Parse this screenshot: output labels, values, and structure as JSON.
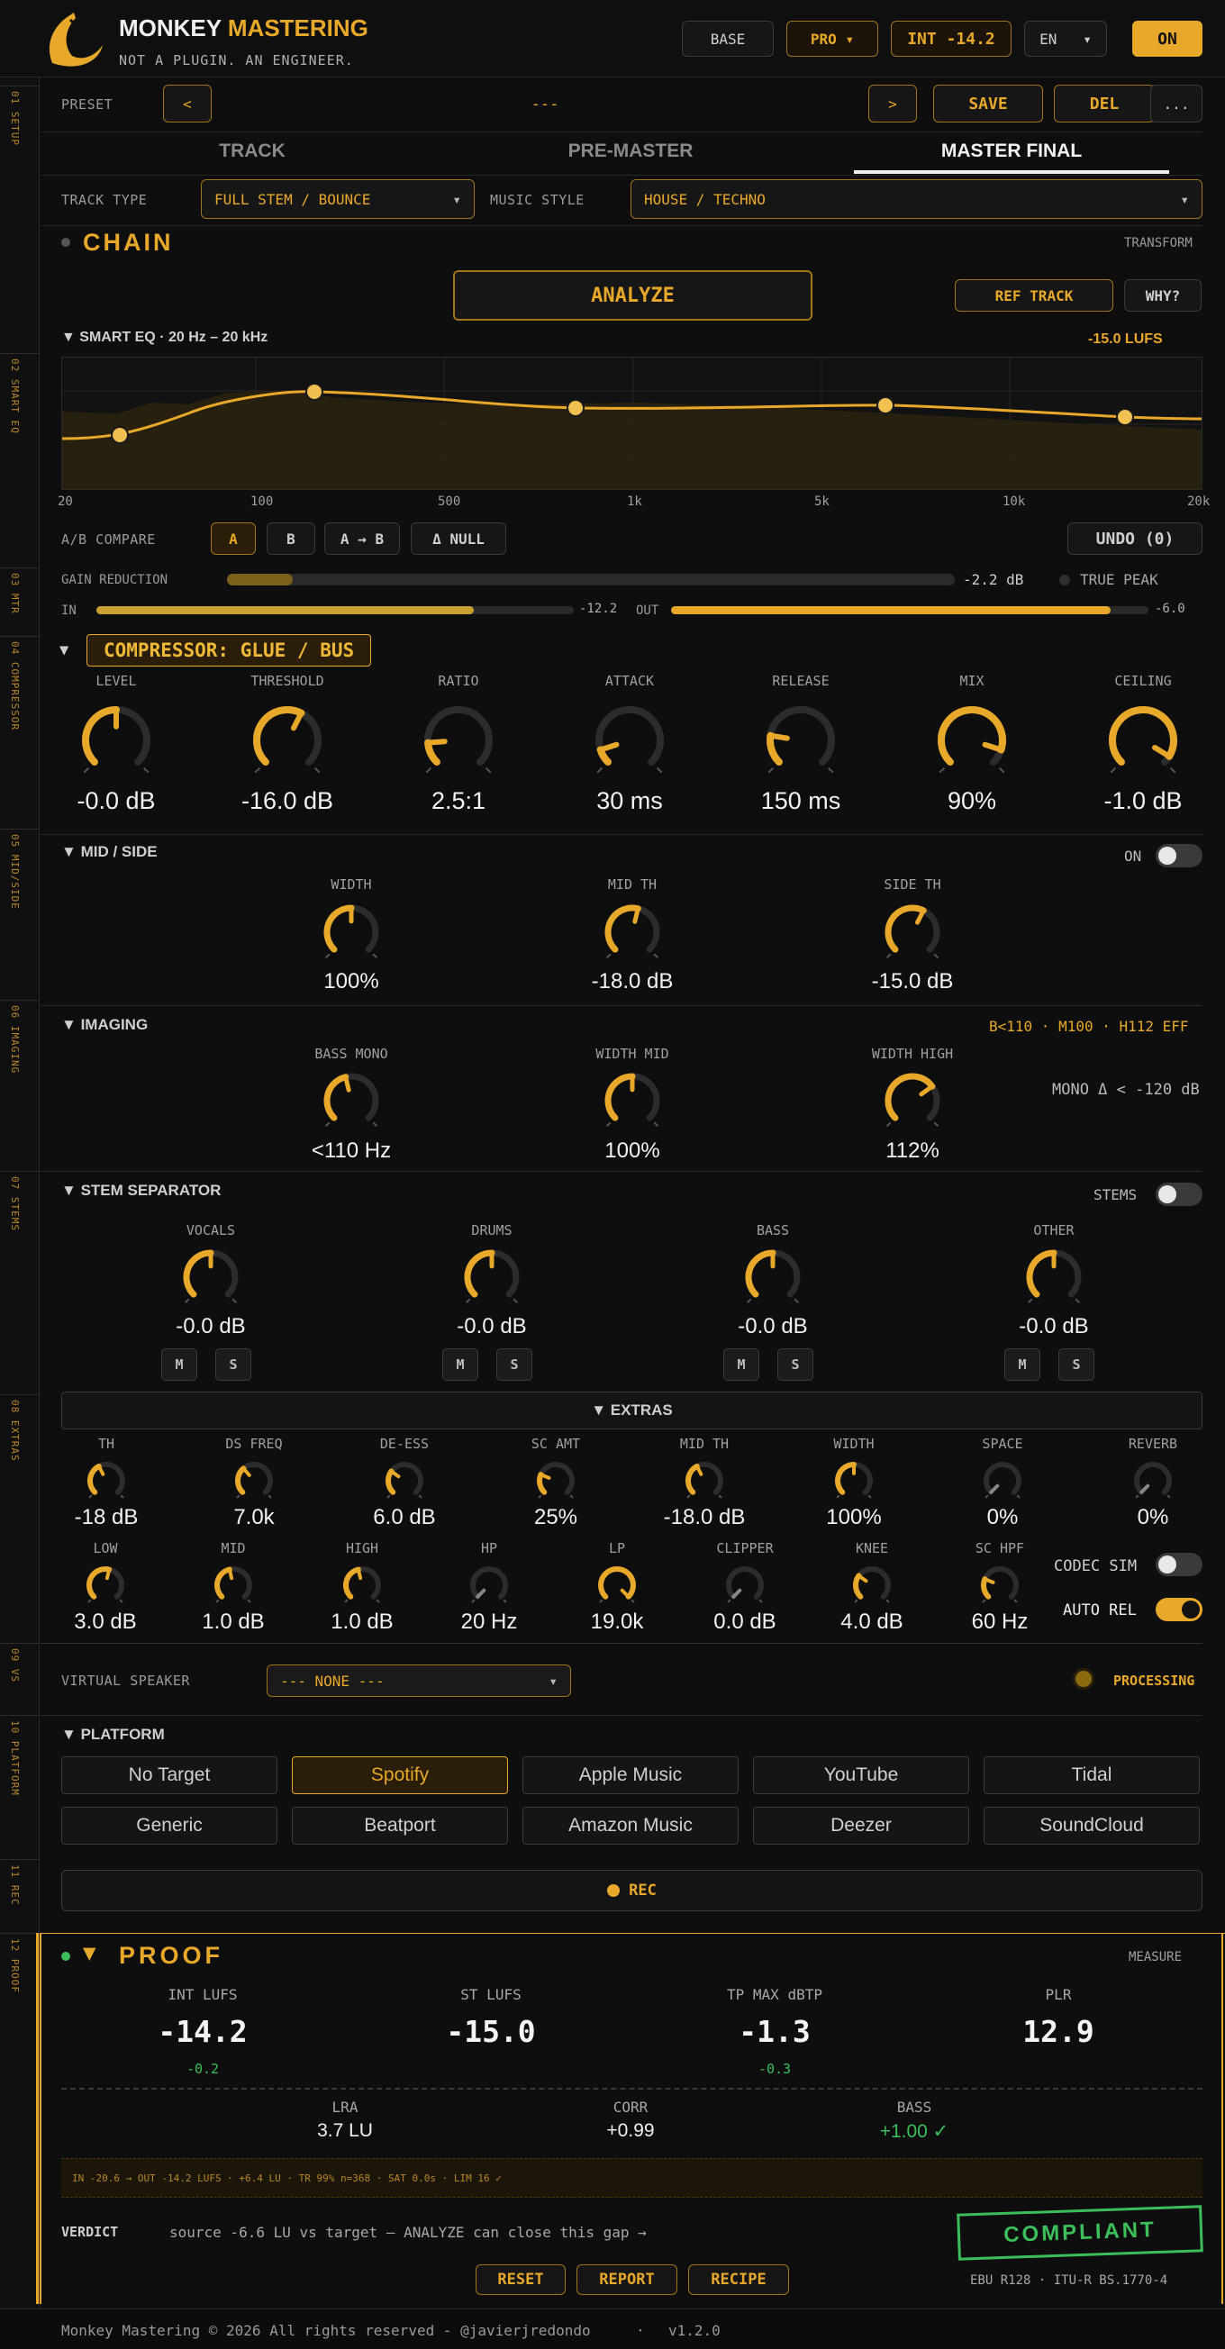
{
  "brand": {
    "name1": "MONKEY",
    "name2": "MASTERING",
    "tagline": "NOT A PLUGIN. AN ENGINEER."
  },
  "header": {
    "base": "BASE",
    "pro": "PRO",
    "int": "INT -14.2",
    "lang": "EN",
    "power": "ON"
  },
  "rail": [
    "01 SETUP",
    "02 SMART EQ",
    "03 MTR",
    "04 COMPRESSOR",
    "05 MID/SIDE",
    "06 IMAGING",
    "07 STEMS",
    "08 EXTRAS",
    "09 VS",
    "10 PLATFORM",
    "11 REC",
    "12 PROOF"
  ],
  "preset": {
    "label": "PRESET",
    "prev": "<",
    "value": "---",
    "next": ">",
    "save": "SAVE",
    "del": "DEL",
    "more": "..."
  },
  "tabs": [
    "TRACK",
    "PRE-MASTER",
    "MASTER FINAL"
  ],
  "setup": {
    "track_type_label": "TRACK TYPE",
    "track_type": "FULL STEM / BOUNCE",
    "music_style_label": "MUSIC STYLE",
    "music_style": "HOUSE / TECHNO"
  },
  "chain": {
    "title": "CHAIN",
    "transform": "TRANSFORM",
    "analyze": "ANALYZE",
    "ref": "REF TRACK",
    "why": "WHY?"
  },
  "eq": {
    "title": "SMART EQ · 20 Hz – 20 kHz",
    "lufs": "-15.0 LUFS",
    "freq_labels": [
      "20",
      "100",
      "500",
      "1k",
      "5k",
      "10k",
      "20k"
    ],
    "ab_label": "A/B COMPARE",
    "ab": [
      "A",
      "B",
      "A → B",
      "Δ NULL"
    ],
    "undo": "UNDO (0)"
  },
  "meters": {
    "gr_label": "GAIN REDUCTION",
    "gr_value": "-2.2 dB",
    "gr_fraction": 0.09,
    "true_peak": "TRUE PEAK",
    "in_label": "IN",
    "in_value": "-12.2",
    "in_fraction": 0.79,
    "out_label": "OUT",
    "out_value": "-6.0",
    "out_fraction": 0.92
  },
  "compressor": {
    "title": "COMPRESSOR: GLUE / BUS",
    "knobs": [
      {
        "label": "LEVEL",
        "value": "-0.0 dB",
        "level": 0.5
      },
      {
        "label": "THRESHOLD",
        "value": "-16.0 dB",
        "level": 0.6
      },
      {
        "label": "RATIO",
        "value": "2.5:1",
        "level": 0.15
      },
      {
        "label": "ATTACK",
        "value": "30 ms",
        "level": 0.1
      },
      {
        "label": "RELEASE",
        "value": "150 ms",
        "level": 0.2
      },
      {
        "label": "MIX",
        "value": "90%",
        "level": 0.9
      },
      {
        "label": "CEILING",
        "value": "-1.0 dB",
        "level": 0.95
      }
    ]
  },
  "midside": {
    "title": "MID / SIDE",
    "toggle": "ON",
    "knobs": [
      {
        "label": "WIDTH",
        "value": "100%",
        "level": 0.5
      },
      {
        "label": "MID TH",
        "value": "-18.0 dB",
        "level": 0.55
      },
      {
        "label": "SIDE TH",
        "value": "-15.0 dB",
        "level": 0.6
      }
    ]
  },
  "imaging": {
    "title": "IMAGING",
    "info": "B<110 · M100 · H112 EFF",
    "mono": "MONO Δ < -120 dB",
    "knobs": [
      {
        "label": "BASS MONO",
        "value": "<110 Hz",
        "level": 0.45
      },
      {
        "label": "WIDTH MID",
        "value": "100%",
        "level": 0.5
      },
      {
        "label": "WIDTH HIGH",
        "value": "112%",
        "level": 0.7
      }
    ]
  },
  "stems": {
    "title": "STEM SEPARATOR",
    "toggle": "STEMS",
    "m": "M",
    "s": "S",
    "knobs": [
      {
        "label": "VOCALS",
        "value": "-0.0 dB",
        "level": 0.5
      },
      {
        "label": "DRUMS",
        "value": "-0.0 dB",
        "level": 0.5
      },
      {
        "label": "BASS",
        "value": "-0.0 dB",
        "level": 0.5
      },
      {
        "label": "OTHER",
        "value": "-0.0 dB",
        "level": 0.5
      }
    ]
  },
  "extras": {
    "title": "▼ EXTRAS",
    "codec": "CODEC SIM",
    "autorel": "AUTO REL",
    "row1": [
      {
        "label": "TH",
        "value": "-18 dB",
        "level": 0.4
      },
      {
        "label": "DS FREQ",
        "value": "7.0k",
        "level": 0.35
      },
      {
        "label": "DE-ESS",
        "value": "6.0 dB",
        "level": 0.3
      },
      {
        "label": "SC AMT",
        "value": "25%",
        "level": 0.25
      },
      {
        "label": "MID TH",
        "value": "-18.0 dB",
        "level": 0.4
      },
      {
        "label": "WIDTH",
        "value": "100%",
        "level": 0.5
      },
      {
        "label": "SPACE",
        "value": "0%",
        "level": 0.0
      },
      {
        "label": "REVERB",
        "value": "0%",
        "level": 0.0
      }
    ],
    "row2": [
      {
        "label": "LOW",
        "value": "3.0 dB",
        "level": 0.55
      },
      {
        "label": "MID",
        "value": "1.0 dB",
        "level": 0.45
      },
      {
        "label": "HIGH",
        "value": "1.0 dB",
        "level": 0.45
      },
      {
        "label": "HP",
        "value": "20 Hz",
        "level": 0.0
      },
      {
        "label": "LP",
        "value": "19.0k",
        "level": 1.0
      },
      {
        "label": "CLIPPER",
        "value": "0.0 dB",
        "level": 0.0
      },
      {
        "label": "KNEE",
        "value": "4.0 dB",
        "level": 0.3
      },
      {
        "label": "SC HPF",
        "value": "60 Hz",
        "level": 0.25
      }
    ]
  },
  "vs": {
    "label": "VIRTUAL SPEAKER",
    "value": "--- NONE ---",
    "processing": "PROCESSING"
  },
  "platform": {
    "title": "PLATFORM",
    "items": [
      "No Target",
      "Spotify",
      "Apple Music",
      "YouTube",
      "Tidal",
      "Generic",
      "Beatport",
      "Amazon Music",
      "Deezer",
      "SoundCloud"
    ],
    "selected": "Spotify"
  },
  "rec": {
    "label": "REC"
  },
  "proof": {
    "title": "PROOF",
    "measure": "MEASURE",
    "metrics": [
      {
        "label": "INT LUFS",
        "value": "-14.2",
        "delta": "-0.2"
      },
      {
        "label": "ST LUFS",
        "value": "-15.0",
        "delta": ""
      },
      {
        "label": "TP MAX dBTP",
        "value": "-1.3",
        "delta": "-0.3"
      },
      {
        "label": "PLR",
        "value": "12.9",
        "delta": ""
      }
    ],
    "sub": [
      {
        "label": "LRA",
        "value": "3.7 LU"
      },
      {
        "label": "CORR",
        "value": "+0.99"
      },
      {
        "label": "BASS",
        "value": "+1.00 ✓"
      }
    ],
    "log": "IN -20.6 → OUT -14.2 LUFS · +6.4 LU · TR 99% n=368 · SAT 0.0s · LIM 16  ✓",
    "verdict_label": "VERDICT",
    "verdict": "source -6.6 LU vs target — ANALYZE can close this gap →",
    "stamp": "COMPLIANT",
    "reset": "RESET",
    "report": "REPORT",
    "recipe": "RECIPE",
    "standard": "EBU R128 · ITU-R BS.1770-4"
  },
  "footer": {
    "text": "Monkey Mastering © 2026 All rights reserved - @javierjredondo",
    "version": "v1.2.0"
  },
  "colors": {
    "accent": "#e8a82a",
    "bg": "#0e0e0e",
    "ok": "#3cbf5a"
  }
}
